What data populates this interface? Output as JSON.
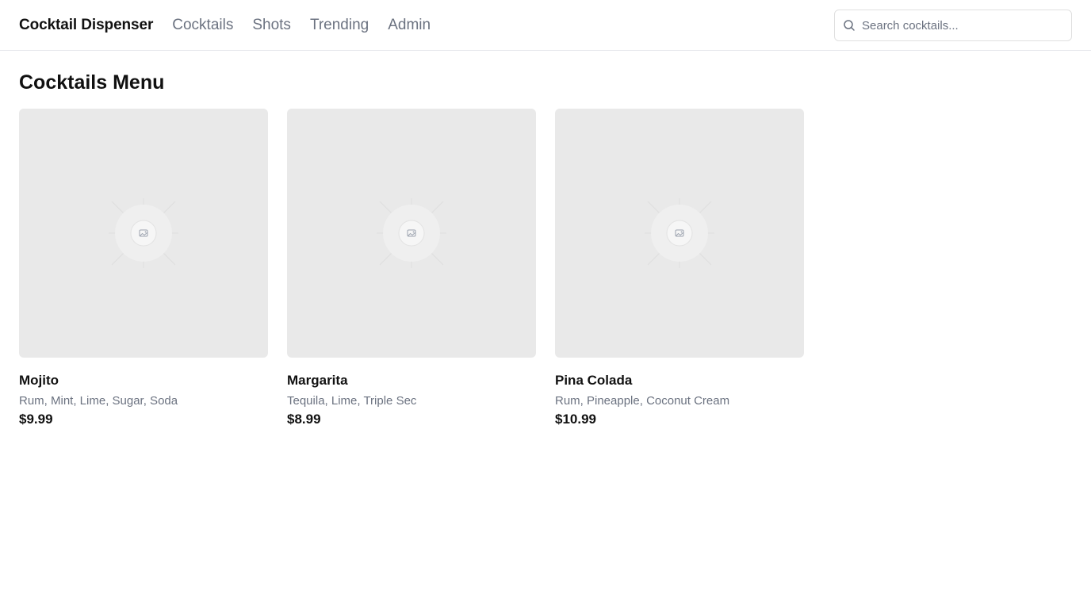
{
  "header": {
    "brand": "Cocktail Dispenser",
    "nav": [
      "Cocktails",
      "Shots",
      "Trending",
      "Admin"
    ],
    "search": {
      "placeholder": "Search cocktails...",
      "value": "",
      "icon": "search-icon"
    }
  },
  "main": {
    "title": "Cocktails Menu",
    "cocktails": [
      {
        "name": "Mojito",
        "ingredients": "Rum, Mint, Lime, Sugar, Soda",
        "price": "$9.99",
        "image": "image-placeholder-icon"
      },
      {
        "name": "Margarita",
        "ingredients": "Tequila, Lime, Triple Sec",
        "price": "$8.99",
        "image": "image-placeholder-icon"
      },
      {
        "name": "Pina Colada",
        "ingredients": "Rum, Pineapple, Coconut Cream",
        "price": "$10.99",
        "image": "image-placeholder-icon"
      }
    ]
  },
  "colors": {
    "text": "#111111",
    "muted": "#6b7280",
    "border": "#e5e7eb",
    "placeholder_bg": "#e9e9e9"
  }
}
